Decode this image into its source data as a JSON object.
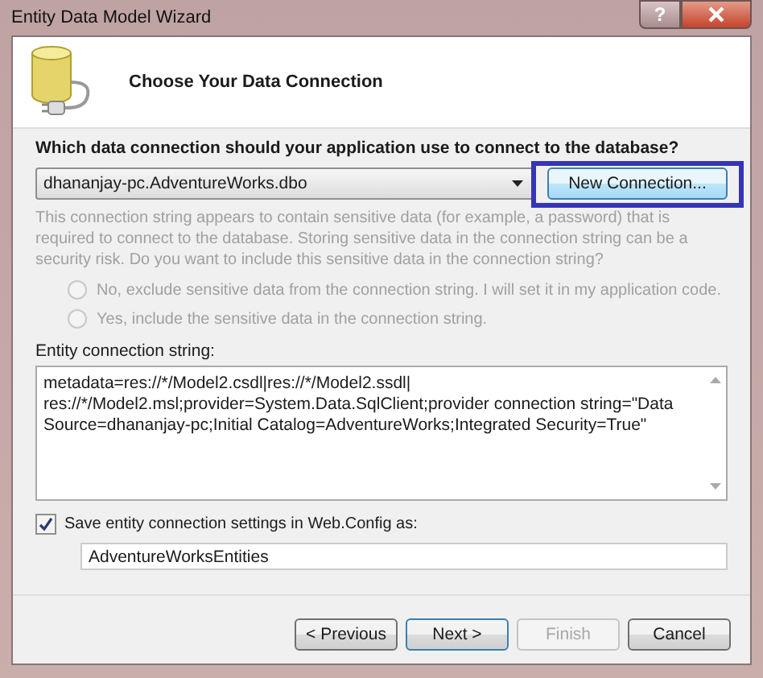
{
  "window": {
    "title": "Entity Data Model Wizard",
    "help_label": "?"
  },
  "header": {
    "title": "Choose Your Data Connection"
  },
  "connection": {
    "question": "Which data connection should your application use to connect to the database?",
    "selected_connection": "dhananjay-pc.AdventureWorks.dbo",
    "new_connection_button": "New Connection...",
    "highlighted": true
  },
  "sensitive_data": {
    "message": "This connection string appears to contain sensitive data (for example, a password) that is required to connect to the database. Storing sensitive data in the connection string can be a security risk. Do you want to include this sensitive data in the connection string?",
    "disabled": true,
    "options": [
      {
        "label": "No, exclude sensitive data from the connection string. I will set it in my application code.",
        "selected": false
      },
      {
        "label": "Yes, include the sensitive data in the connection string.",
        "selected": false
      }
    ]
  },
  "entity_connection": {
    "label": "Entity connection string:",
    "lines": [
      "metadata=res://*/Model2.csdl|res://*/Model2.ssdl|",
      "res://*/Model2.msl;provider=System.Data.SqlClient;provider connection string=\"Data",
      "Source=dhananjay-pc;Initial Catalog=AdventureWorks;Integrated Security=True\""
    ]
  },
  "save_settings": {
    "label": "Save entity connection settings in Web.Config as:",
    "checked": true,
    "value": "AdventureWorksEntities"
  },
  "buttons": [
    {
      "label": "< Previous",
      "disabled": false,
      "default": false
    },
    {
      "label": "Next >",
      "disabled": false,
      "default": true
    },
    {
      "label": "Finish",
      "disabled": true,
      "default": false
    },
    {
      "label": "Cancel",
      "disabled": false,
      "default": false
    }
  ]
}
